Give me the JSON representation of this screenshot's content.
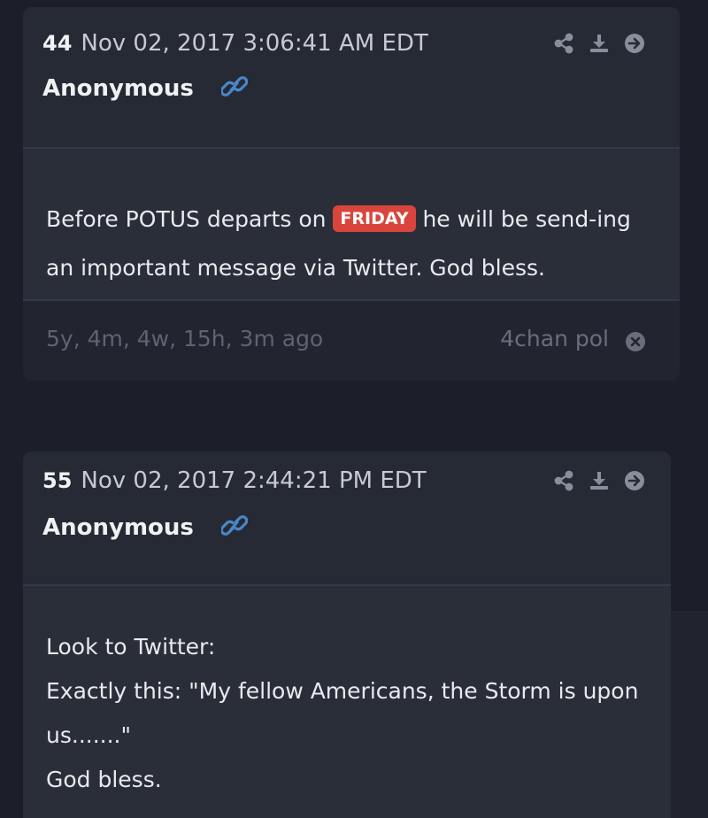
{
  "posts": [
    {
      "number": "44",
      "date": "Nov 02, 2017 3:06:41 AM EDT",
      "author": "Anonymous",
      "body_before": "Before POTUS departs on ",
      "tag": "FRIDAY",
      "body_after": " he will be send-ing an important message via Twitter. God bless.",
      "age": "5y, 4m, 4w, 15h, 3m ago",
      "source": "4chan pol"
    },
    {
      "number": "55",
      "date": "Nov 02, 2017 2:44:21 PM EDT",
      "author": "Anonymous",
      "lines": [
        "Look to Twitter:",
        "Exactly this: \"My fellow Americans, the Storm is upon us.......\"",
        "God bless."
      ]
    }
  ],
  "icons": {
    "link": "link-icon",
    "share": "share-icon",
    "download": "download-icon",
    "go": "arrow-right-circle-icon",
    "remove": "close-circle-icon"
  },
  "colors": {
    "background": "#1c1f29",
    "card": "#262a35",
    "tag_red": "#d9453c",
    "link_blue": "#4a86c8"
  }
}
